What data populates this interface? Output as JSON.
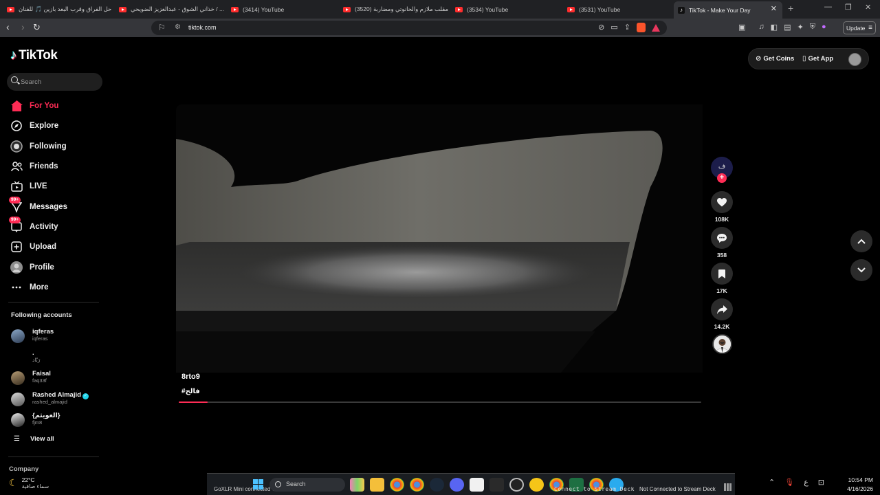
{
  "browser": {
    "tabs": [
      {
        "title": "حل الفراق وقرب البعد بازين 🎵 للفنان",
        "kind": "youtube"
      },
      {
        "title": "خذاني الشوق - عبدالعزيز الضويحي / ...",
        "kind": "youtube"
      },
      {
        "title": "(3414) YouTube",
        "kind": "youtube"
      },
      {
        "title": "(3520) مقلب ملازم والحانوتي ومضاربة",
        "kind": "youtube"
      },
      {
        "title": "(3534) YouTube",
        "kind": "youtube"
      },
      {
        "title": "(3531) YouTube",
        "kind": "youtube"
      },
      {
        "title": "TikTok - Make Your Day",
        "kind": "tiktok"
      }
    ],
    "url": "tiktok.com",
    "update_label": "Update"
  },
  "sidebar": {
    "logo": "TikTok",
    "search_placeholder": "Search",
    "nav": [
      {
        "label": "For You",
        "icon": "home-icon",
        "active": true
      },
      {
        "label": "Explore",
        "icon": "compass-icon"
      },
      {
        "label": "Following",
        "icon": "following-icon"
      },
      {
        "label": "Friends",
        "icon": "friends-icon"
      },
      {
        "label": "LIVE",
        "icon": "live-tv-icon"
      },
      {
        "label": "Messages",
        "icon": "messages-icon",
        "badge": "99+"
      },
      {
        "label": "Activity",
        "icon": "activity-icon",
        "badge": "99+"
      },
      {
        "label": "Upload",
        "icon": "upload-icon"
      },
      {
        "label": "Profile",
        "icon": "profile-avatar-icon"
      },
      {
        "label": "More",
        "icon": "more-dots-icon"
      }
    ],
    "following_title": "Following accounts",
    "accounts": [
      {
        "name": "iqferas",
        "handle": "iqferas",
        "verified": false
      },
      {
        "name": ".",
        "handle": "رَنّاد",
        "verified": false
      },
      {
        "name": "Faisal",
        "handle": "faq33f",
        "verified": false
      },
      {
        "name": "Rashed Almajid",
        "handle": "rashed_almajid",
        "verified": true
      },
      {
        "name": "{الغويثم}",
        "handle": "fjm8",
        "verified": false
      }
    ],
    "view_all": "View all",
    "company": "Company"
  },
  "top_actions": {
    "get_coins": "Get Coins",
    "get_app": "Get App"
  },
  "video": {
    "author": "8rto9",
    "caption": "#فالح",
    "progress": 0.055
  },
  "actions": {
    "creator_initial": "ف",
    "likes": "108K",
    "comments": "358",
    "saves": "17K",
    "shares": "14.2K"
  },
  "weather": {
    "temperature": "22°C",
    "condition": "سماء صافية"
  },
  "taskbar": {
    "goxlr": "GoXLR Mini connected via USB",
    "search": "Search",
    "stream_deck": "Connect to Stream Deck",
    "not_connected": "Not Connected to Stream Deck",
    "lang": "ع",
    "time": "10:54 PM",
    "date": "4/16/2026"
  },
  "colors": {
    "accent": "#fe2c55",
    "background": "#000000",
    "tiktok_cyan": "#25f4ee"
  }
}
